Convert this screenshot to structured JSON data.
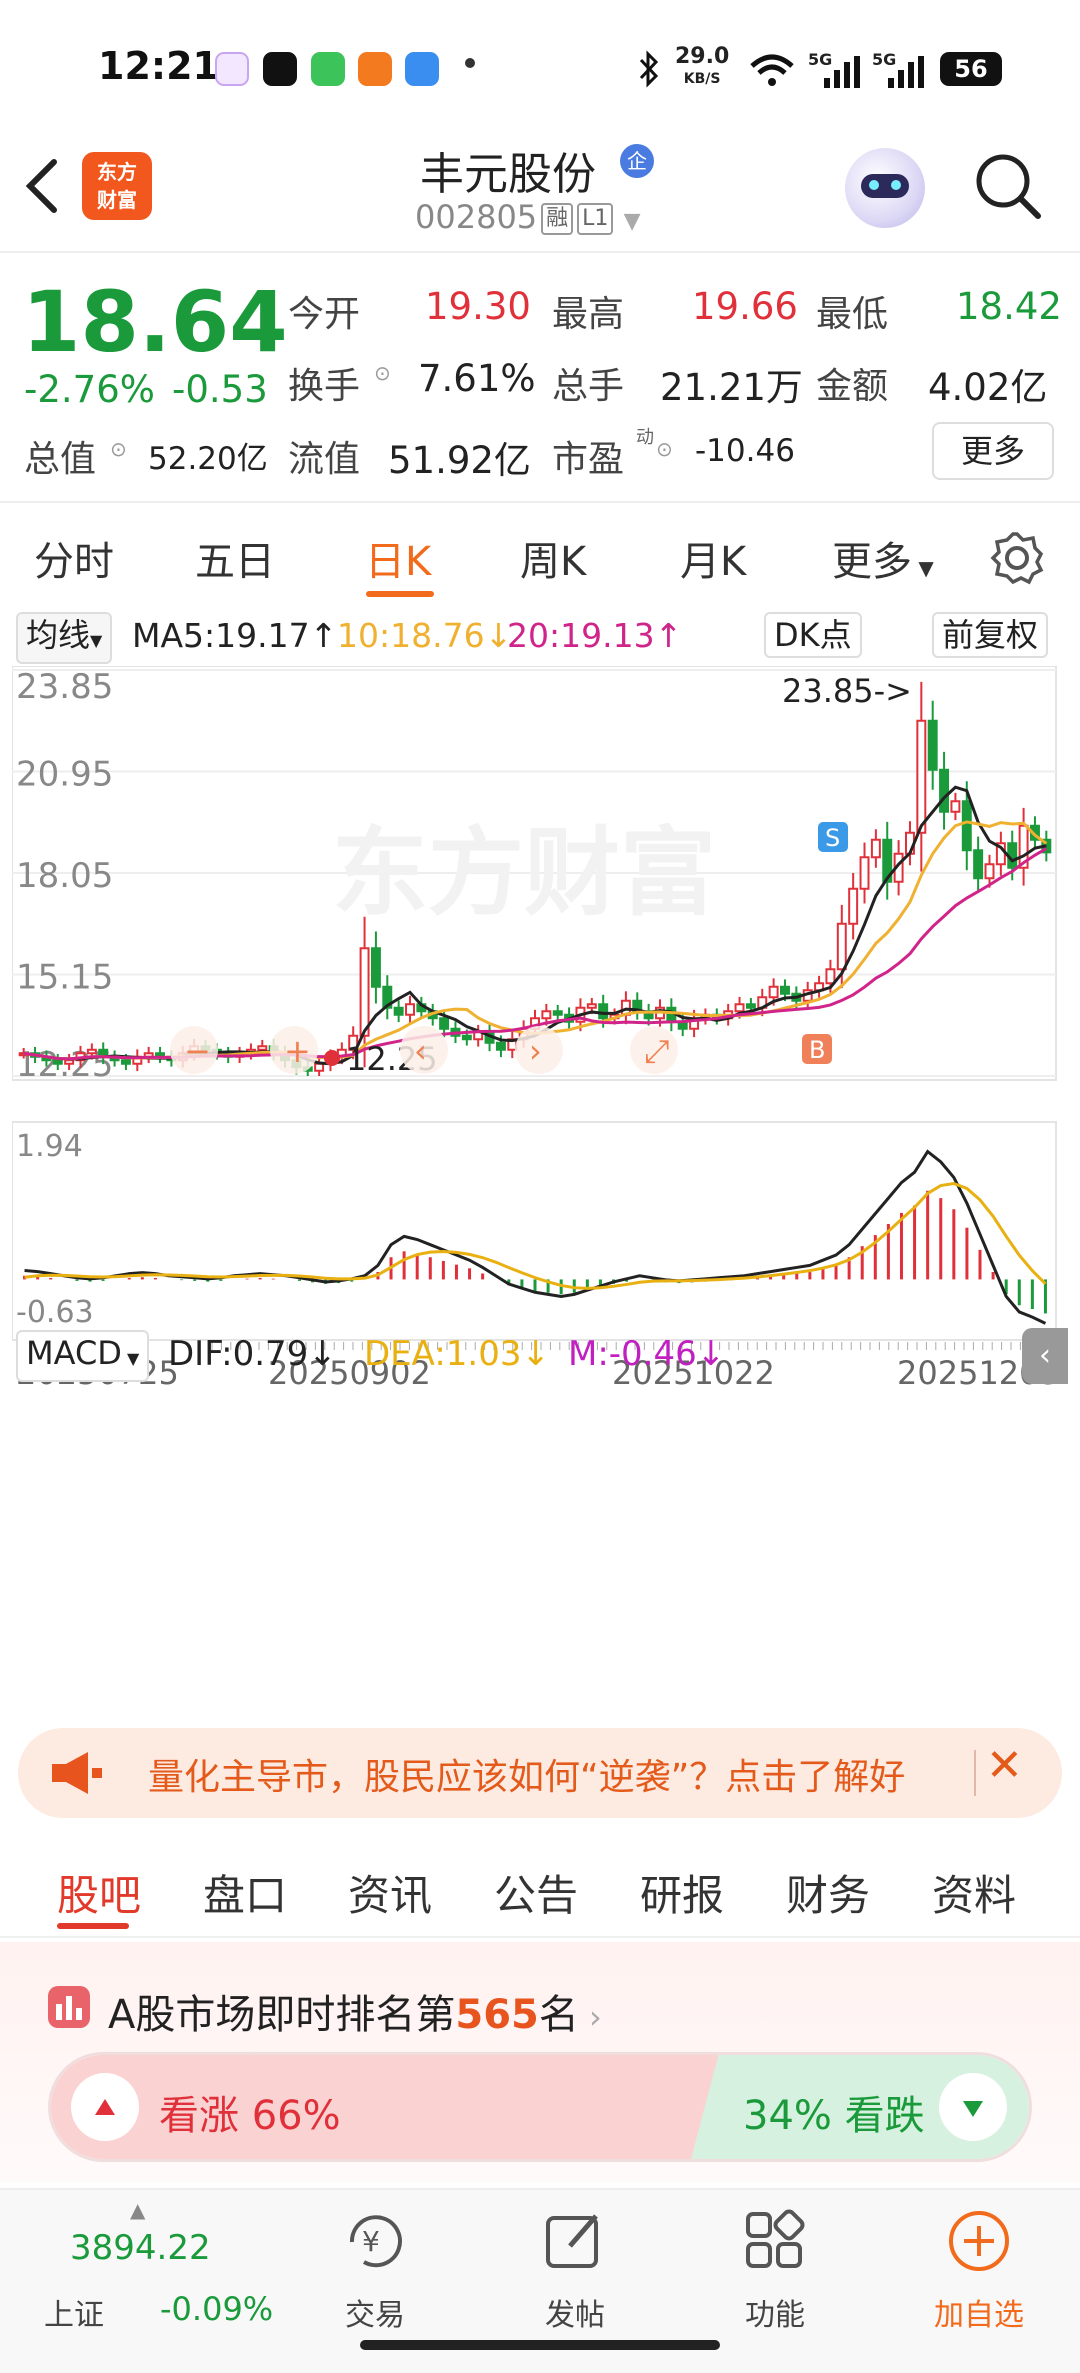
{
  "status_bar": {
    "time": "12:21",
    "net_speed_top": "29.0",
    "net_speed_unit": "KB/S",
    "signal1": "5G",
    "signal2": "5G",
    "battery": "56"
  },
  "header": {
    "logo_line1": "东方",
    "logo_line2": "财富",
    "stock_name": "丰元股份",
    "badge": "企",
    "code": "002805",
    "tag1": "融",
    "tag2": "L1"
  },
  "quote": {
    "price": "18.64",
    "change_pct": "-2.76%",
    "change_abs": "-0.53",
    "market_cap_label": "总值",
    "market_cap": "52.20亿",
    "open_label": "今开",
    "open": "19.30",
    "high_label": "最高",
    "high": "19.66",
    "low_label": "最低",
    "low": "18.42",
    "turnover_label": "换手",
    "turnover": "7.61%",
    "volume_label": "总手",
    "volume": "21.21万",
    "amount_label": "金额",
    "amount": "4.02亿",
    "float_label": "流值",
    "float_cap": "51.92亿",
    "pe_label": "市盈",
    "pe_sup": "动",
    "pe": "-10.46",
    "more": "更多"
  },
  "tabs": [
    "分时",
    "五日",
    "日K",
    "周K",
    "月K",
    "更多"
  ],
  "active_tab": "日K",
  "chart_controls": {
    "ma_select": "均线",
    "ma5": "MA5:19.17↑",
    "ma10": "10:18.76↓",
    "ma20": "20:19.13↑",
    "dk": "DK点",
    "adjust": "前复权",
    "macd_select": "MACD",
    "dif": "DIF:0.79↓",
    "dea": "DEA:1.03↓",
    "m": "M:-0.46↓",
    "watermark": "东方财富",
    "high_marker": "23.85->",
    "low_marker": "12.25",
    "sell_marker": "S",
    "buy_marker": "B"
  },
  "chart_data": {
    "type": "candlestick",
    "price_axis_ticks": [
      "23.85",
      "20.95",
      "18.05",
      "15.15",
      "12.25"
    ],
    "price_range": [
      12.25,
      23.85
    ],
    "macd_axis_ticks": [
      "1.94",
      "-0.63"
    ],
    "macd_range": [
      -0.63,
      1.94
    ],
    "date_ticks": [
      "20250725",
      "20250902",
      "20251022",
      "20251203"
    ],
    "ma5_last": 19.17,
    "ma10_last": 18.76,
    "ma20_last": 19.13,
    "series_colors": {
      "ma5": "#222222",
      "ma10": "#f0b030",
      "ma20": "#d0248a",
      "up": "#e0303a",
      "down": "#1a9a3a"
    },
    "close_approx": [
      12.9,
      12.8,
      12.7,
      12.6,
      12.7,
      12.9,
      13.0,
      12.8,
      12.7,
      12.6,
      12.8,
      12.9,
      12.8,
      12.7,
      12.9,
      13.1,
      13.0,
      12.9,
      12.8,
      12.9,
      13.0,
      13.1,
      12.9,
      12.7,
      12.5,
      12.4,
      12.6,
      12.8,
      13.0,
      13.4,
      15.9,
      14.8,
      14.2,
      14.0,
      14.3,
      14.1,
      13.9,
      13.6,
      13.4,
      13.3,
      13.5,
      13.2,
      13.0,
      13.3,
      13.6,
      13.9,
      14.1,
      14.0,
      13.8,
      14.2,
      14.3,
      13.9,
      14.0,
      14.4,
      14.1,
      13.9,
      14.2,
      13.8,
      13.6,
      13.9,
      14.0,
      13.9,
      14.1,
      14.3,
      14.2,
      14.5,
      14.8,
      14.6,
      14.4,
      14.7,
      14.9,
      15.3,
      16.6,
      17.6,
      18.5,
      19.0,
      17.8,
      18.6,
      19.2,
      22.4,
      21.0,
      19.8,
      20.1,
      18.7,
      17.9,
      18.3,
      18.9,
      18.2,
      19.4,
      19.0,
      18.64
    ],
    "macd_hist_approx": [
      0.05,
      0.04,
      0.02,
      0.0,
      -0.02,
      -0.03,
      -0.02,
      0.0,
      0.02,
      0.03,
      0.02,
      0.0,
      -0.01,
      -0.02,
      -0.03,
      -0.02,
      0.0,
      0.01,
      0.02,
      0.01,
      0.0,
      -0.02,
      -0.04,
      -0.06,
      -0.05,
      -0.03,
      0.0,
      0.1,
      0.3,
      0.38,
      0.35,
      0.3,
      0.25,
      0.2,
      0.15,
      0.08,
      0.0,
      -0.08,
      -0.12,
      -0.16,
      -0.18,
      -0.2,
      -0.18,
      -0.14,
      -0.1,
      -0.06,
      -0.03,
      0.0,
      -0.02,
      -0.04,
      -0.05,
      -0.04,
      -0.03,
      -0.02,
      -0.01,
      0.0,
      0.02,
      0.04,
      0.06,
      0.08,
      0.1,
      0.15,
      0.2,
      0.3,
      0.45,
      0.6,
      0.75,
      0.9,
      1.0,
      1.2,
      1.1,
      0.95,
      0.7,
      0.4,
      0.1,
      -0.2,
      -0.35,
      -0.4,
      -0.46
    ]
  },
  "banner": {
    "text": "量化主导市，股民应该如何“逆袭”？点击了解好"
  },
  "sub_tabs": [
    "股吧",
    "盘口",
    "资讯",
    "公告",
    "研报",
    "财务",
    "资料"
  ],
  "rank": {
    "prefix": "A股市场即时排名第",
    "num": "565",
    "suffix": "名"
  },
  "sentiment": {
    "bull": "看涨 66%",
    "bear": "34% 看跌",
    "bull_ratio": 0.66
  },
  "bottom_nav": {
    "index_value": "3894.22",
    "index_name": "上证",
    "index_change": "-0.09%",
    "items": [
      "交易",
      "发帖",
      "功能",
      "加自选"
    ]
  }
}
